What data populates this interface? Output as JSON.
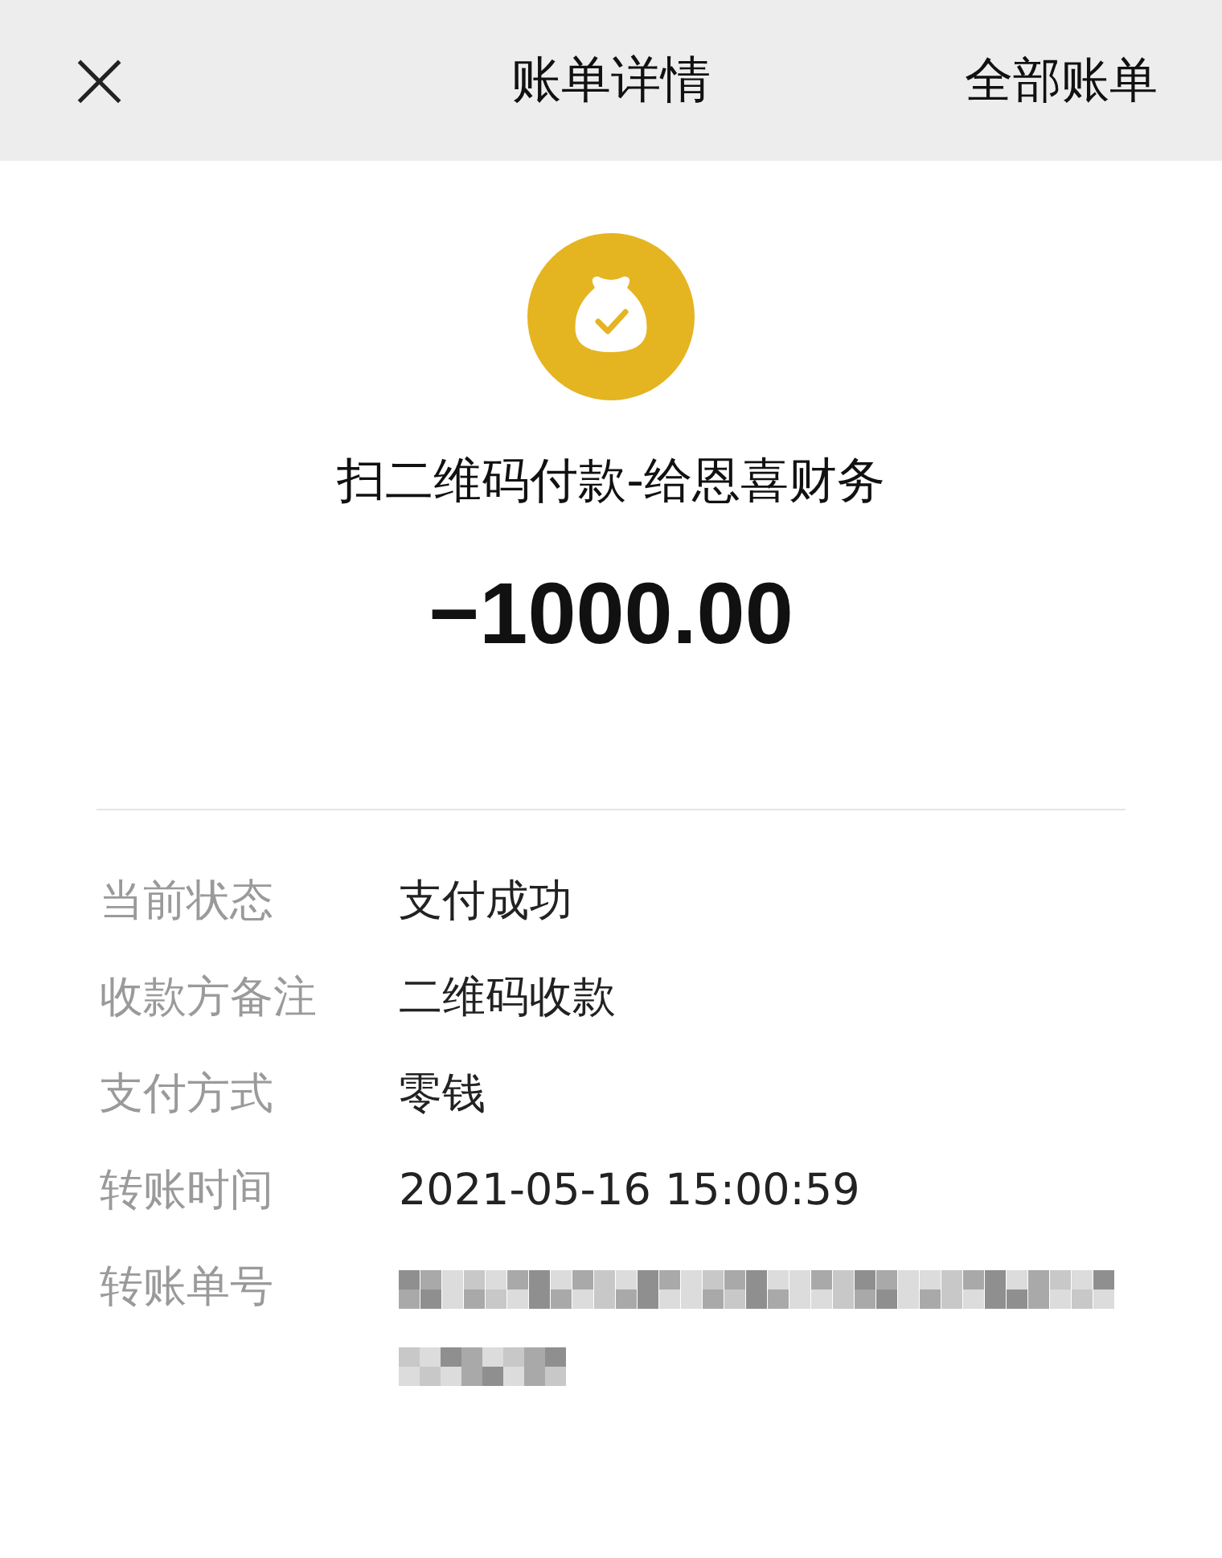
{
  "header": {
    "close": "×",
    "title": "账单详情",
    "action": "全部账单"
  },
  "summary": {
    "merchant": "扫二维码付款-给恩喜财务",
    "amount": "−1000.00"
  },
  "details": [
    {
      "label": "当前状态",
      "value": "支付成功",
      "kind": "text"
    },
    {
      "label": "收款方备注",
      "value": "二维码收款",
      "kind": "text"
    },
    {
      "label": "支付方式",
      "value": "零钱",
      "kind": "text"
    },
    {
      "label": "转账时间",
      "value": "2021-05-16 15:00:59",
      "kind": "text"
    },
    {
      "label": "转账单号",
      "kind": "blurred"
    }
  ]
}
